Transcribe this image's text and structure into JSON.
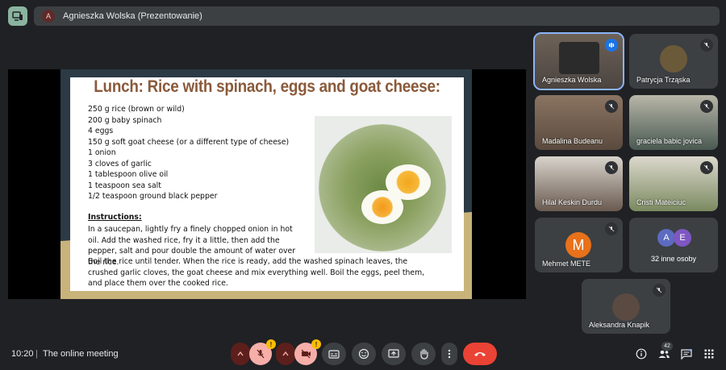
{
  "header": {
    "presenter_initial": "A",
    "presenter_label": "Agnieszka Wolska (Prezentowanie)"
  },
  "slide": {
    "title": "Lunch: Rice with spinach, eggs and goat cheese:",
    "ingredients": [
      "250 g rice (brown or wild)",
      "200 g baby spinach",
      "4 eggs",
      "150 g soft goat cheese (or a different type of cheese)",
      "1 onion",
      "3 cloves of garlic",
      "1 tablespoon olive oil",
      "1 teaspoon sea salt",
      "1/2 teaspoon ground black pepper"
    ],
    "instructions_title": "Instructions:",
    "instructions_short": "In a saucepan, lightly fry a finely chopped onion in hot oil. Add the washed rice, fry it a little, then add the pepper, salt and pour double the amount of water over the rice.",
    "instructions_long": "Boil the rice until tender. When the rice is ready, add the washed spinach leaves, the crushed garlic cloves, the goat cheese and mix everything well. Boil the eggs, peel them, and place them over the cooked rice."
  },
  "participants": [
    {
      "name": "Agnieszka Wolska",
      "state": "speaking"
    },
    {
      "name": "Patrycja Trząska",
      "state": "muted"
    },
    {
      "name": "Madalina Budeanu",
      "state": "muted"
    },
    {
      "name": "graciela babic jovica",
      "state": "muted"
    },
    {
      "name": "Hilal Keskin Durdu",
      "state": "muted"
    },
    {
      "name": "Cristi Mateiciuc",
      "state": "muted"
    },
    {
      "name": "Mehmet METE",
      "initial": "M",
      "state": "muted"
    },
    {
      "name": "32 inne osoby",
      "initials": [
        "A",
        "E"
      ]
    },
    {
      "name": "Aleksandra Knapik",
      "state": "muted"
    }
  ],
  "footer": {
    "time": "10:20",
    "separator": "|",
    "meeting_title": "The online meeting",
    "people_count": "42",
    "warning_mark": "!"
  },
  "colors": {
    "accent": "#8ab4f8",
    "end_call": "#ea4335",
    "mehmet_avatar": "#e8711a",
    "avatar_a": "#5c6bc0",
    "avatar_e": "#7e57c2"
  }
}
